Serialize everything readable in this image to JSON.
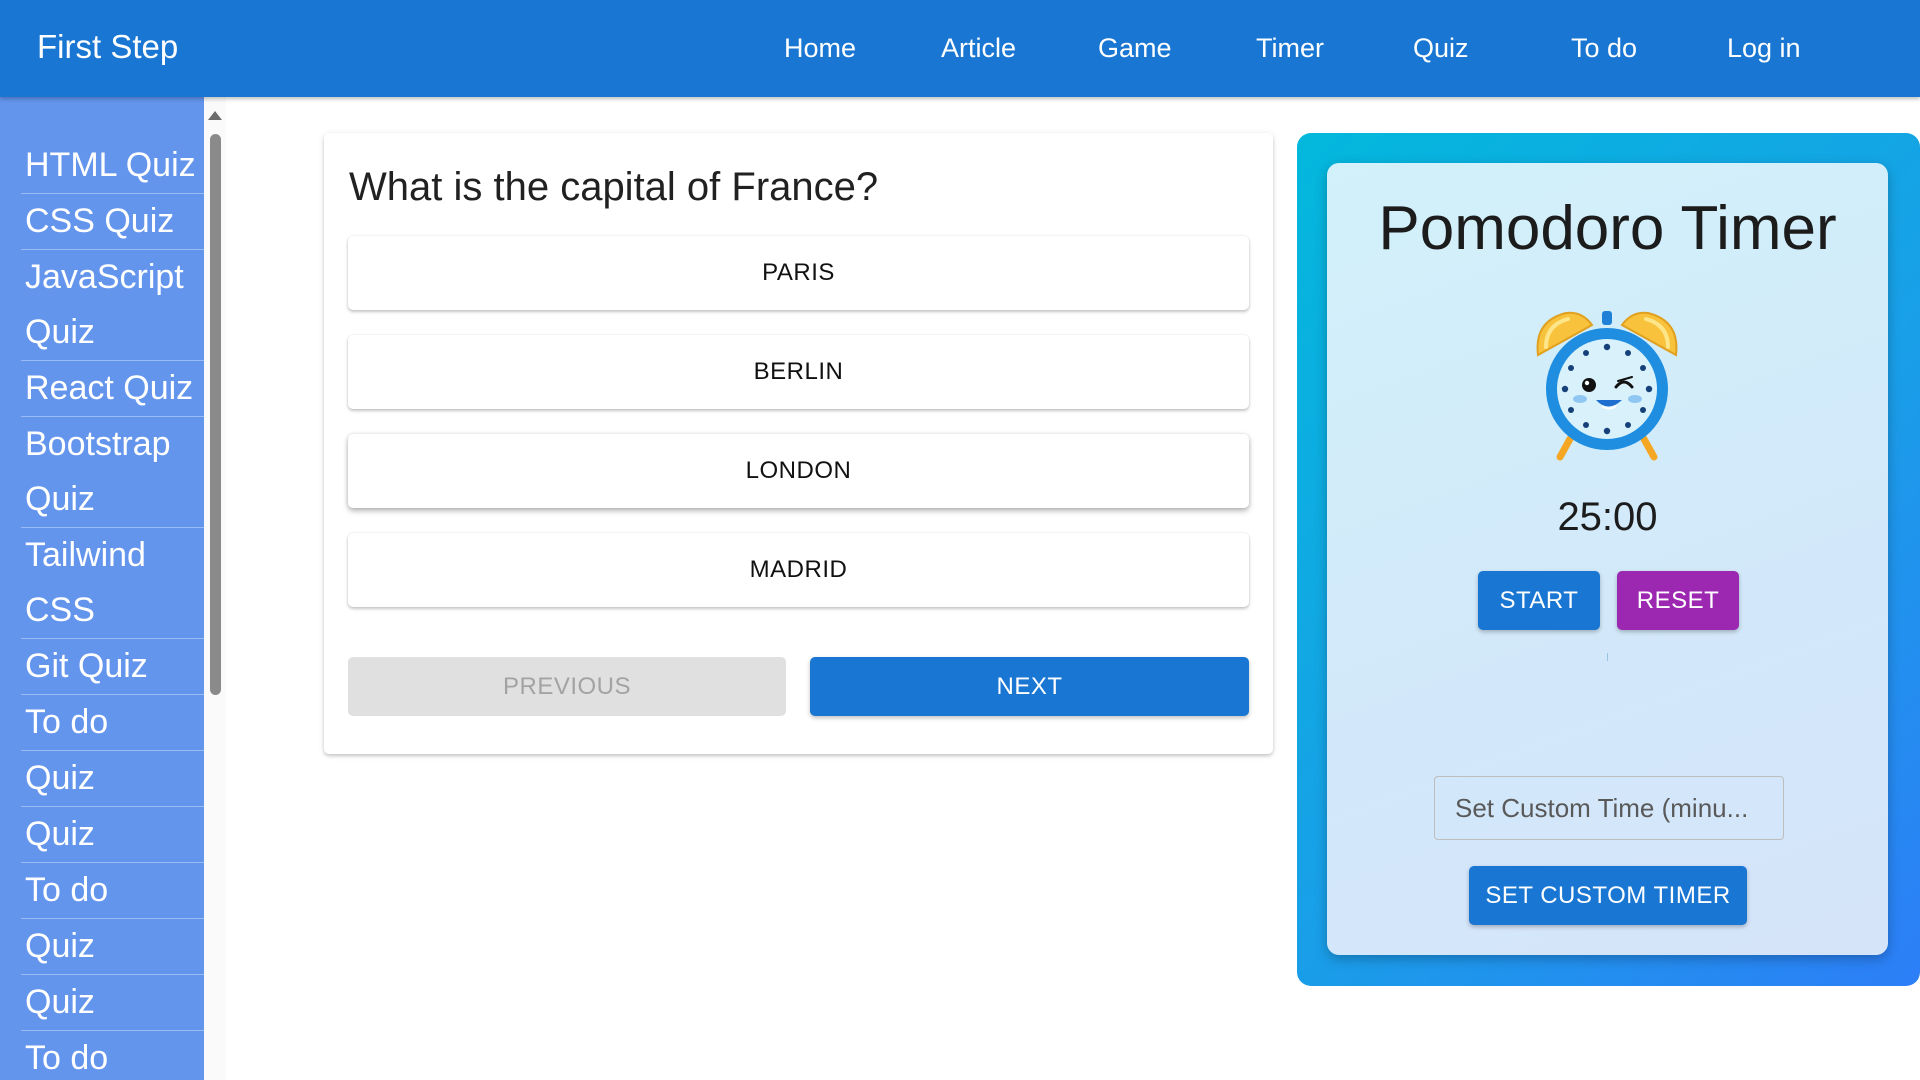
{
  "header": {
    "brand": "First Step",
    "nav": [
      "Home",
      "Article",
      "Game",
      "Timer",
      "Quiz",
      "To do",
      "Log in"
    ]
  },
  "sidebar": {
    "items": [
      [
        "HTML Quiz"
      ],
      [
        "CSS Quiz"
      ],
      [
        "JavaScript",
        "Quiz"
      ],
      [
        "React Quiz"
      ],
      [
        "Bootstrap",
        "Quiz"
      ],
      [
        "Tailwind",
        "CSS"
      ],
      [
        "Git Quiz"
      ],
      [
        "To do"
      ],
      [
        "Quiz"
      ],
      [
        "Quiz"
      ],
      [
        "To do"
      ],
      [
        "Quiz"
      ],
      [
        "Quiz"
      ],
      [
        "To do"
      ]
    ]
  },
  "quiz": {
    "question": "What is the capital of France?",
    "answers": [
      "PARIS",
      "BERLIN",
      "LONDON",
      "MADRID"
    ],
    "previous_label": "PREVIOUS",
    "next_label": "NEXT"
  },
  "timer": {
    "title": "Pomodoro Timer",
    "time": "25:00",
    "start_label": "START",
    "reset_label": "RESET",
    "custom_placeholder": "Set Custom Time (minu...",
    "custom_button_label": "SET CUSTOM TIMER",
    "clock_icon": "alarm-clock-icon"
  },
  "colors": {
    "primary": "#1976d2",
    "reset": "#9c27b0",
    "sidebar": "#6495ed",
    "disabled_bg": "#e0e0e0"
  }
}
